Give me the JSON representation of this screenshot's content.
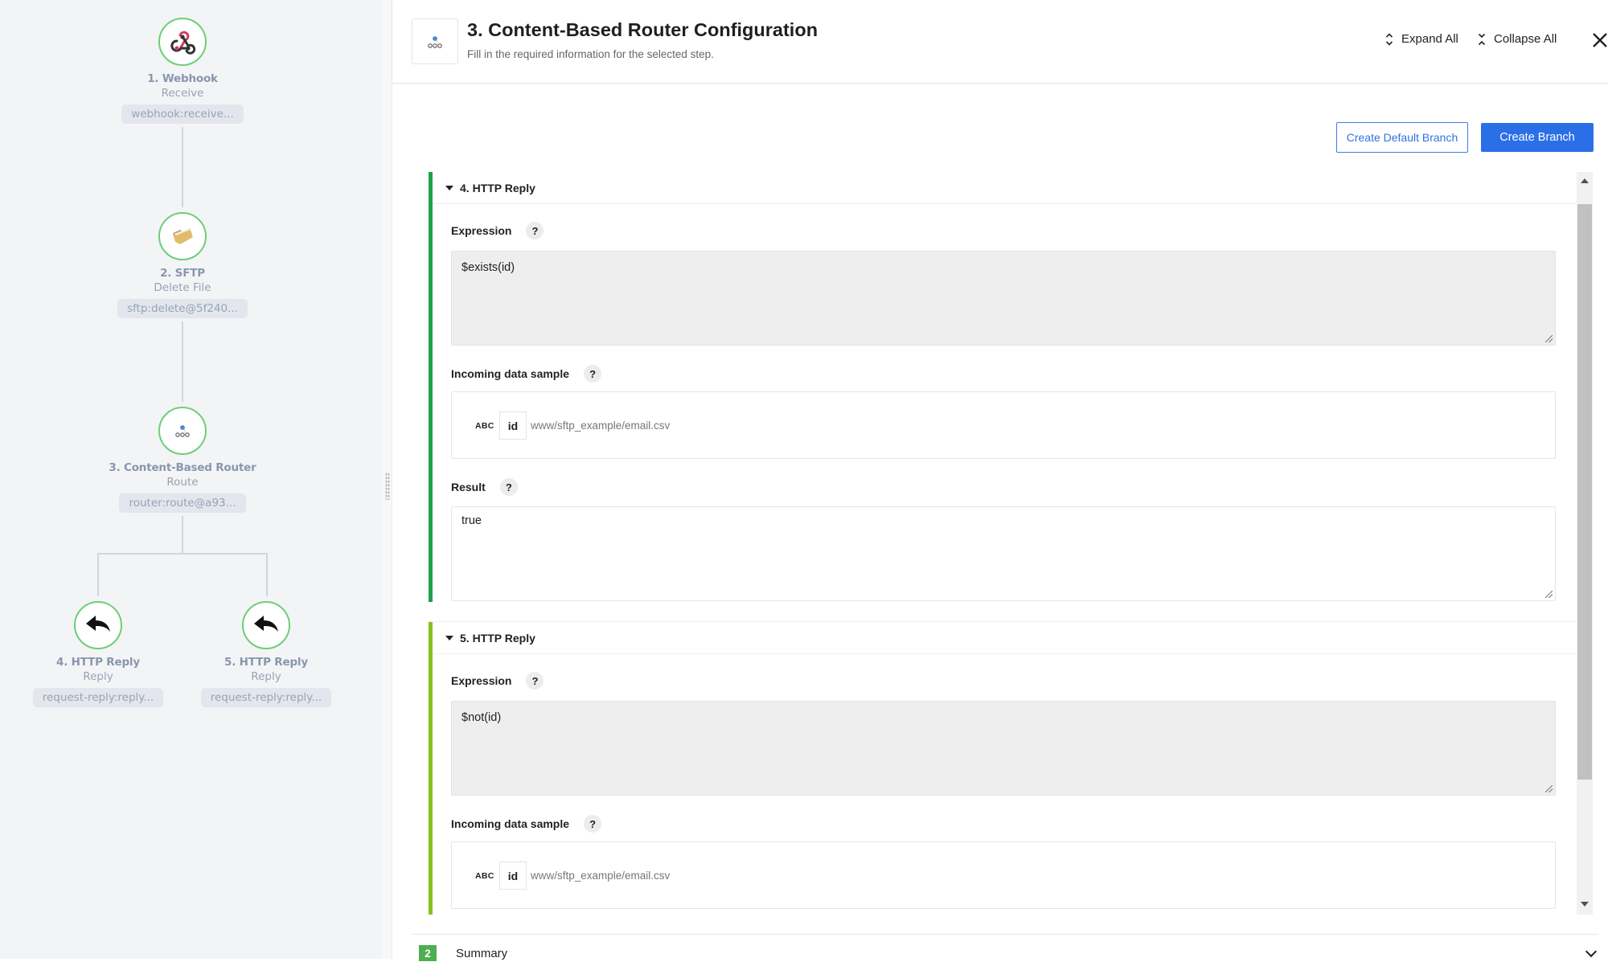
{
  "flow": {
    "nodes": [
      {
        "title": "1. Webhook",
        "subtitle": "Receive",
        "tag": "webhook:receive...",
        "icon": "webhook-icon"
      },
      {
        "title": "2. SFTP",
        "subtitle": "Delete File",
        "tag": "sftp:delete@5f240...",
        "icon": "folder-icon"
      },
      {
        "title": "3. Content-Based Router",
        "subtitle": "Route",
        "tag": "router:route@a93...",
        "icon": "router-icon"
      },
      {
        "title": "4. HTTP Reply",
        "subtitle": "Reply",
        "tag": "request-reply:reply...",
        "icon": "reply-icon"
      },
      {
        "title": "5. HTTP Reply",
        "subtitle": "Reply",
        "tag": "request-reply:reply...",
        "icon": "reply-icon"
      }
    ]
  },
  "header": {
    "title": "3. Content-Based Router Configuration",
    "subtitle": "Fill in the required information for the selected step.",
    "expand_all": "Expand All",
    "collapse_all": "Collapse All"
  },
  "actions": {
    "create_default_branch": "Create Default Branch",
    "create_branch": "Create Branch"
  },
  "branches": [
    {
      "title": "4. HTTP Reply",
      "color": "#1fa04a",
      "expression_label": "Expression",
      "expression": "$exists(id)",
      "sample_label": "Incoming data sample",
      "sample_type": "ABC",
      "sample_key": "id",
      "sample_value": "www/sftp_example/email.csv",
      "result_label": "Result",
      "result": "true"
    },
    {
      "title": "5. HTTP Reply",
      "color": "#86c21d",
      "expression_label": "Expression",
      "expression": "$not(id)",
      "sample_label": "Incoming data sample",
      "sample_type": "ABC",
      "sample_key": "id",
      "sample_value": "www/sftp_example/email.csv"
    }
  ],
  "help_glyph": "?",
  "summary": {
    "step_number": "2",
    "label": "Summary"
  }
}
